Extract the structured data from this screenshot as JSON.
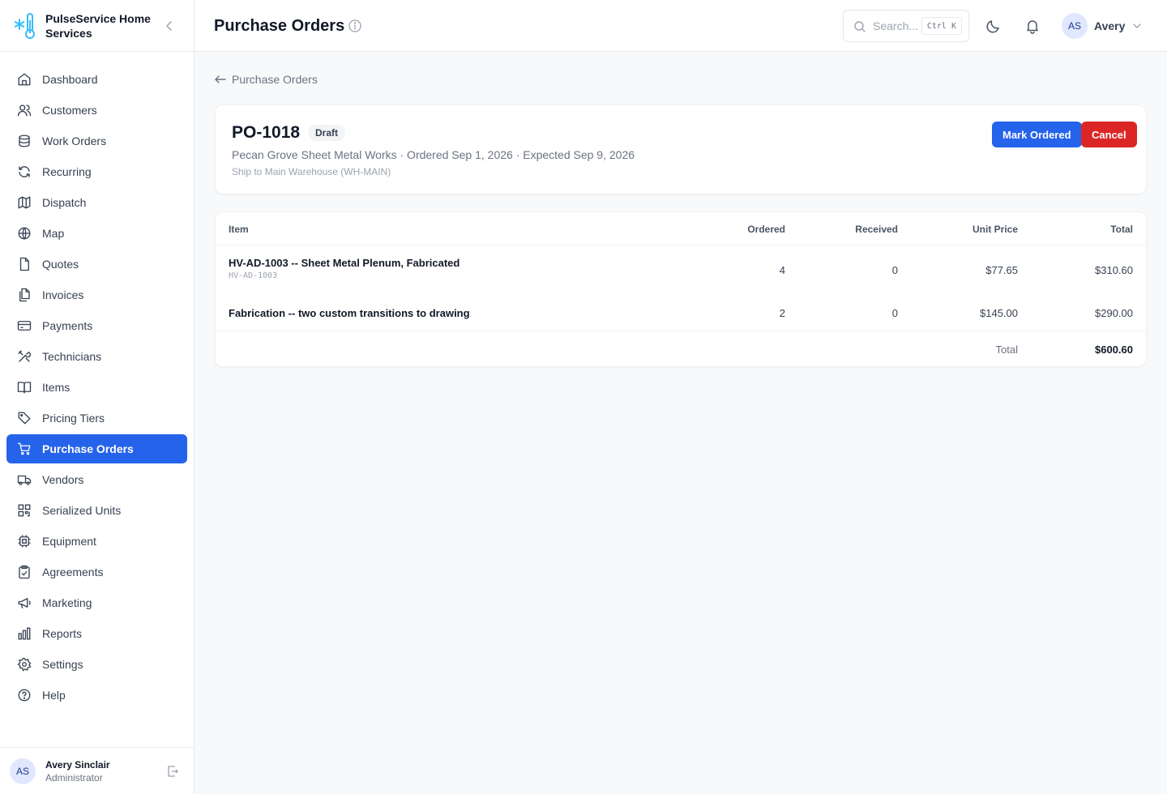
{
  "brand": {
    "name": "PulseService Home Services"
  },
  "nav": {
    "items": [
      {
        "label": "Dashboard",
        "icon": "home-icon"
      },
      {
        "label": "Customers",
        "icon": "users-icon"
      },
      {
        "label": "Work Orders",
        "icon": "clipboard-icon"
      },
      {
        "label": "Recurring",
        "icon": "refresh-icon"
      },
      {
        "label": "Dispatch",
        "icon": "map-fold-icon"
      },
      {
        "label": "Map",
        "icon": "globe-icon"
      },
      {
        "label": "Quotes",
        "icon": "file-icon"
      },
      {
        "label": "Invoices",
        "icon": "files-icon"
      },
      {
        "label": "Payments",
        "icon": "credit-card-icon"
      },
      {
        "label": "Technicians",
        "icon": "tools-icon"
      },
      {
        "label": "Items",
        "icon": "book-icon"
      },
      {
        "label": "Pricing Tiers",
        "icon": "tag-icon"
      },
      {
        "label": "Purchase Orders",
        "icon": "cart-icon",
        "active": true
      },
      {
        "label": "Vendors",
        "icon": "truck-icon"
      },
      {
        "label": "Serialized Units",
        "icon": "qr-icon"
      },
      {
        "label": "Equipment",
        "icon": "chip-icon"
      },
      {
        "label": "Agreements",
        "icon": "clipboard-check-icon"
      },
      {
        "label": "Marketing",
        "icon": "megaphone-icon"
      },
      {
        "label": "Reports",
        "icon": "bar-chart-icon"
      },
      {
        "label": "Settings",
        "icon": "gear-icon"
      },
      {
        "label": "Help",
        "icon": "help-circle-icon"
      }
    ]
  },
  "current_user": {
    "initials": "AS",
    "name": "Avery Sinclair",
    "role": "Administrator"
  },
  "header": {
    "title": "Purchase Orders",
    "search_placeholder": "Search...",
    "search_shortcut": "Ctrl K",
    "user_initials": "AS",
    "user_name": "Avery"
  },
  "back_link": "Purchase Orders",
  "po": {
    "number": "PO-1018",
    "status": "Draft",
    "meta": "Pecan Grove Sheet Metal Works · Ordered Sep 1, 2026 · Expected Sep 9, 2026",
    "ship_to": "Ship to Main Warehouse (WH-MAIN)",
    "actions": {
      "mark_ordered": "Mark Ordered",
      "cancel": "Cancel"
    }
  },
  "line_items": {
    "columns": {
      "item": "Item",
      "ordered": "Ordered",
      "received": "Received",
      "unit_price": "Unit Price",
      "total": "Total"
    },
    "rows": [
      {
        "name": "HV-AD-1003 -- Sheet Metal Plenum, Fabricated",
        "sku": "HV-AD-1003",
        "ordered": "4",
        "received": "0",
        "unit_price": "$77.65",
        "total": "$310.60"
      },
      {
        "name": "Fabrication -- two custom transitions to drawing",
        "sku": "",
        "ordered": "2",
        "received": "0",
        "unit_price": "$145.00",
        "total": "$290.00"
      }
    ],
    "total_label": "Total",
    "total_value": "$600.60"
  },
  "colors": {
    "accent": "#2563eb",
    "danger": "#dc2626",
    "brand_icon": "#38bdf8"
  }
}
